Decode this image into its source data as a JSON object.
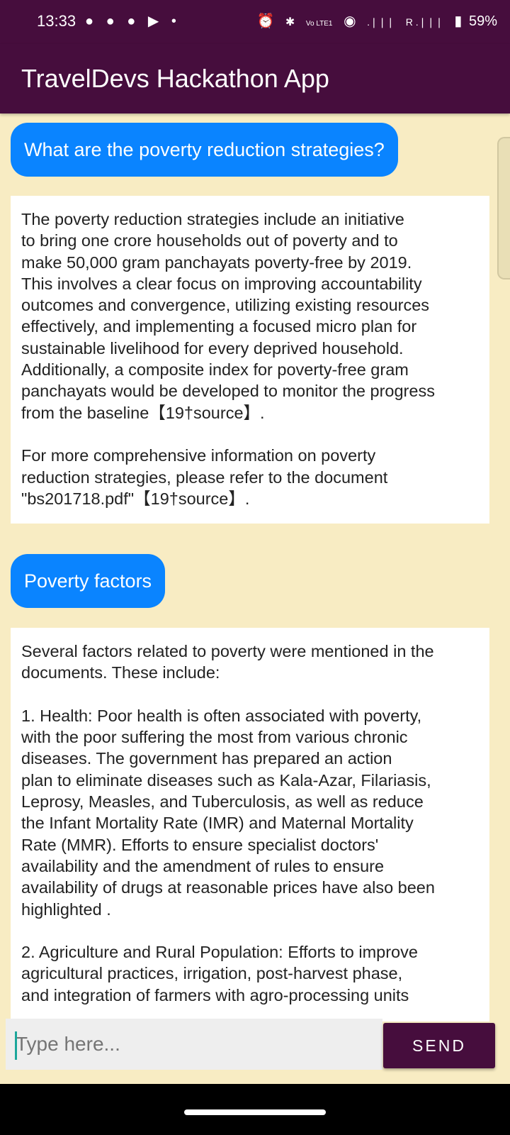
{
  "status_bar": {
    "time": "13:33",
    "left_icons": "● ● ● ▶ •",
    "right_icons": [
      "⏰",
      "✱",
      "Vo LTE1",
      "◉",
      ".❘❘❘",
      "R .❘❘❘",
      "▮"
    ],
    "battery": "59%"
  },
  "app_bar": {
    "title": "TravelDevs Hackathon App"
  },
  "messages": [
    {
      "role": "user",
      "text": "What are the poverty reduction strategies?"
    },
    {
      "role": "assistant",
      "text": "The poverty reduction strategies include an initiative\nto bring one crore households out of poverty and to\nmake 50,000 gram panchayats poverty-free by 2019.\nThis involves a clear focus on improving accountability\noutcomes and convergence, utilizing existing resources\neffectively, and implementing a focused micro plan for\nsustainable livelihood for every deprived household.\nAdditionally, a composite index for poverty-free gram\npanchayats would be developed to monitor the progress\nfrom the baseline【19†source】.\n\nFor more comprehensive information on poverty\nreduction strategies, please refer to the document\n\"bs201718.pdf\"【19†source】."
    },
    {
      "role": "user",
      "text": "Poverty factors"
    },
    {
      "role": "assistant",
      "text": "Several factors related to poverty were mentioned in the\ndocuments. These include:\n\n1. Health: Poor health is often associated with poverty,\nwith the poor suffering the most from various chronic\ndiseases. The government has prepared an action\nplan to eliminate diseases such as Kala-Azar, Filariasis,\nLeprosy, Measles, and Tuberculosis, as well as reduce\nthe Infant Mortality Rate (IMR) and Maternal Mortality\nRate (MMR). Efforts to ensure specialist doctors'\navailability and the amendment of rules to ensure\navailability of drugs at reasonable prices have also been\nhighlighted .\n\n2. Agriculture and Rural Population: Efforts to improve\nagricultural practices, irrigation, post-harvest phase,\nand integration of farmers with agro-processing units"
    }
  ],
  "input": {
    "placeholder": "Type here...",
    "value": ""
  },
  "send_label": "SEND",
  "colors": {
    "app_bar": "#460d3d",
    "background": "#f8ecc3",
    "user_bubble": "#0a84ff",
    "send_button": "#460d3d"
  }
}
